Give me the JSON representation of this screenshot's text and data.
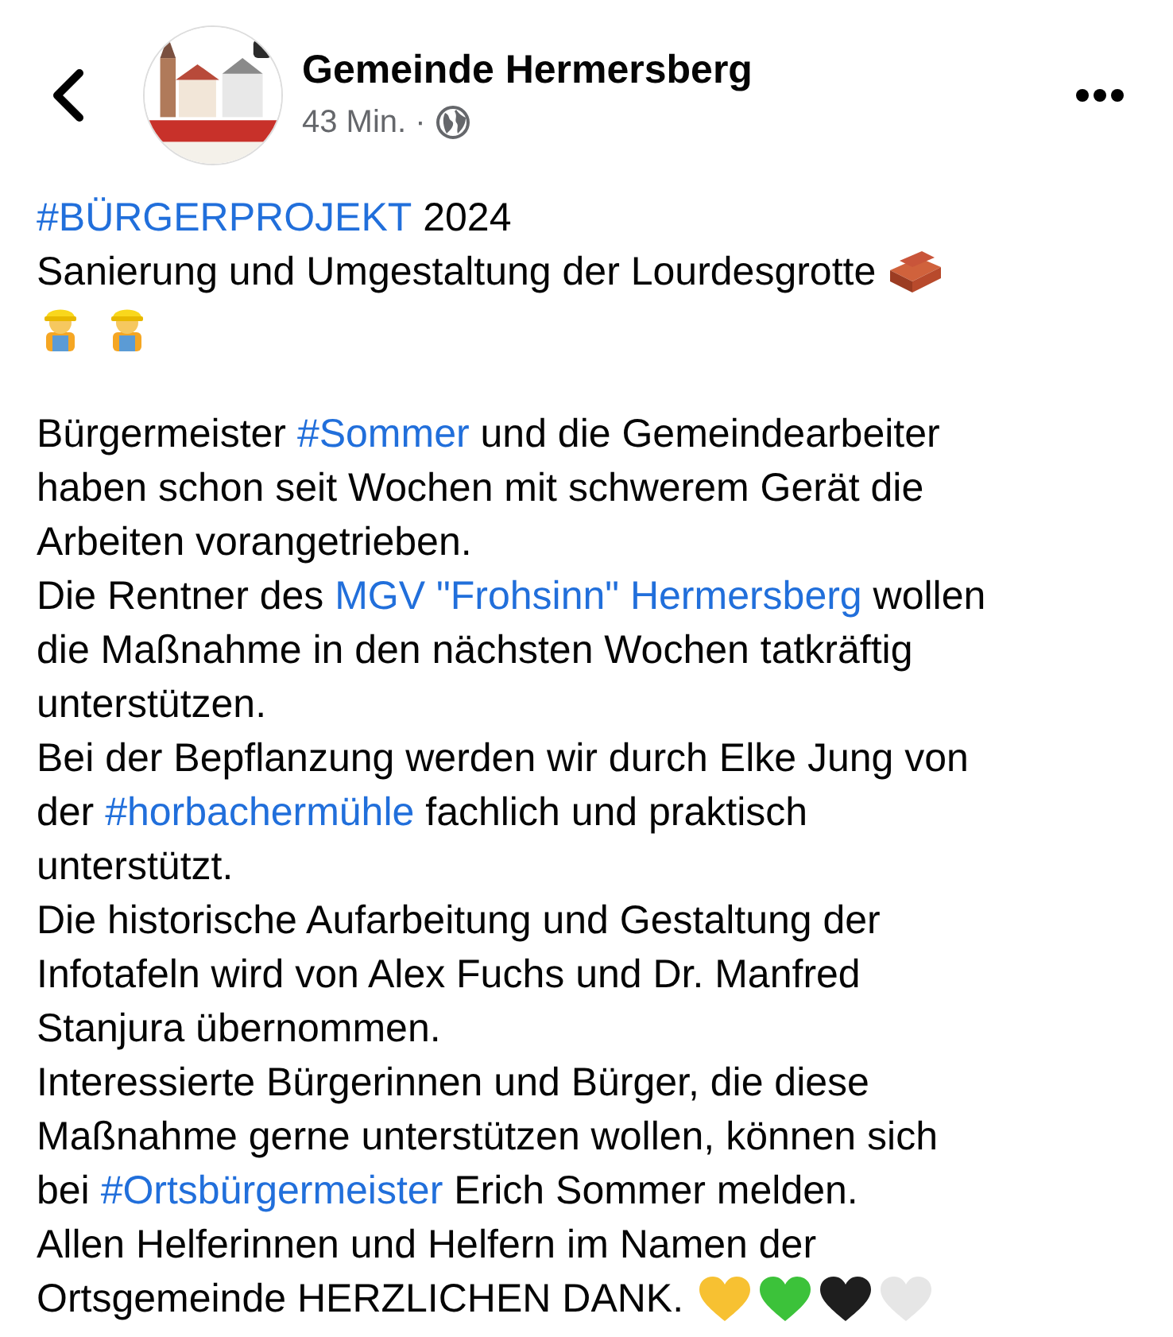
{
  "header": {
    "page_name": "Gemeinde Hermersberg",
    "time": "43 Min. ·"
  },
  "post": {
    "lines": [
      [
        {
          "kind": "hashtag",
          "text": "#BÜRGERPROJEKT"
        },
        {
          "kind": "text",
          "text": " 2024"
        }
      ],
      [
        {
          "kind": "text",
          "text": "Sanierung und Umgestaltung der Lourdesgrotte "
        },
        {
          "kind": "brick"
        }
      ],
      [
        {
          "kind": "worker"
        },
        {
          "kind": "worker"
        }
      ]
    ],
    "body_lines": [
      [
        {
          "kind": "text",
          "text": "Bürgermeister "
        },
        {
          "kind": "hashtag",
          "text": "#Sommer"
        },
        {
          "kind": "text",
          "text": " und die Gemeindearbeiter"
        }
      ],
      [
        {
          "kind": "text",
          "text": "haben schon seit Wochen mit schwerem Gerät die"
        }
      ],
      [
        {
          "kind": "text",
          "text": "Arbeiten vorangetrieben."
        }
      ],
      [
        {
          "kind": "text",
          "text": "Die Rentner des "
        },
        {
          "kind": "hashtag",
          "text": "MGV \"Frohsinn\" Hermersberg"
        },
        {
          "kind": "text",
          "text": " wollen"
        }
      ],
      [
        {
          "kind": "text",
          "text": "die Maßnahme in den nächsten Wochen tatkräftig"
        }
      ],
      [
        {
          "kind": "text",
          "text": "unterstützen."
        }
      ],
      [
        {
          "kind": "text",
          "text": "Bei der Bepflanzung werden wir durch Elke Jung von"
        }
      ],
      [
        {
          "kind": "text",
          "text": "der "
        },
        {
          "kind": "hashtag",
          "text": "#horbachermühle"
        },
        {
          "kind": "text",
          "text": " fachlich und praktisch"
        }
      ],
      [
        {
          "kind": "text",
          "text": "unterstützt."
        }
      ],
      [
        {
          "kind": "text",
          "text": "Die historische Aufarbeitung und Gestaltung der"
        }
      ],
      [
        {
          "kind": "text",
          "text": "Infotafeln wird von Alex Fuchs und Dr. Manfred"
        }
      ],
      [
        {
          "kind": "text",
          "text": "Stanjura übernommen."
        }
      ],
      [
        {
          "kind": "text",
          "text": "Interessierte Bürgerinnen und Bürger, die diese"
        }
      ],
      [
        {
          "kind": "text",
          "text": "Maßnahme gerne unterstützen wollen, können sich"
        }
      ],
      [
        {
          "kind": "text",
          "text": "bei "
        },
        {
          "kind": "hashtag",
          "text": "#Ortsbürgermeister"
        },
        {
          "kind": "text",
          "text": " Erich Sommer melden."
        }
      ],
      [
        {
          "kind": "text",
          "text": "Allen Helferinnen und Helfern im Namen der"
        }
      ],
      [
        {
          "kind": "text",
          "text": "Ortsgemeinde HERZLICHEN DANK. "
        },
        {
          "kind": "heart",
          "color": "#f7c132"
        },
        {
          "kind": "heart",
          "color": "#3cc23a"
        },
        {
          "kind": "heart",
          "color": "#1e1e1e"
        },
        {
          "kind": "heart",
          "color": "#e6e6e6"
        }
      ]
    ]
  }
}
